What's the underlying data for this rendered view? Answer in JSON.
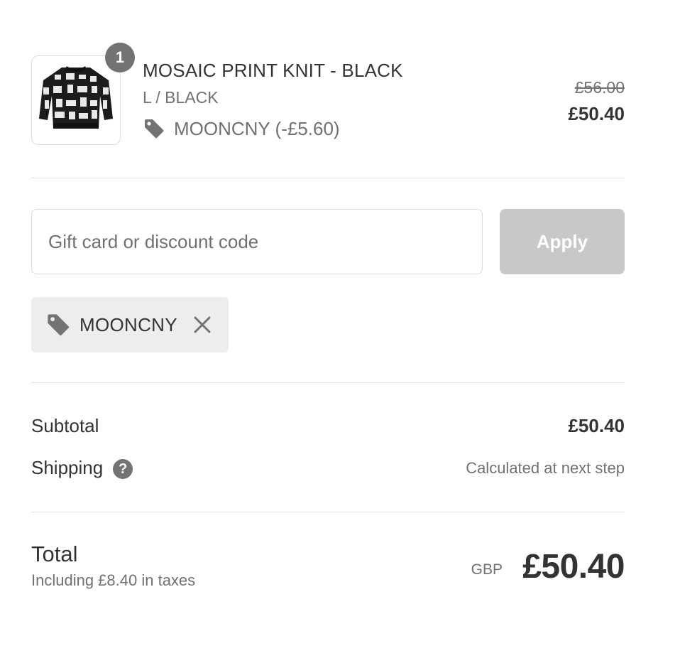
{
  "product": {
    "quantity": "1",
    "name": "MOSAIC PRINT KNIT - BLACK",
    "variant": "L / BLACK",
    "discount_line": "MOONCNY (-£5.60)",
    "original_price": "£56.00",
    "price": "£50.40"
  },
  "discount_form": {
    "placeholder": "Gift card or discount code",
    "value": "",
    "apply_label": "Apply"
  },
  "applied_code": {
    "label": "MOONCNY"
  },
  "summary": {
    "subtotal_label": "Subtotal",
    "subtotal_value": "£50.40",
    "shipping_label": "Shipping",
    "shipping_help": "?",
    "shipping_value": "Calculated at next step",
    "total_label": "Total",
    "tax_note": "Including £8.40 in taxes",
    "currency": "GBP",
    "total_value": "£50.40"
  },
  "icons": {
    "tag": "tag-icon",
    "close": "close-icon",
    "help": "question-mark-icon"
  },
  "colors": {
    "apply_disabled": "#c8c8c8",
    "badge": "#737373",
    "chip_bg": "#ededed",
    "text_primary": "#333333",
    "text_secondary": "#717171"
  }
}
